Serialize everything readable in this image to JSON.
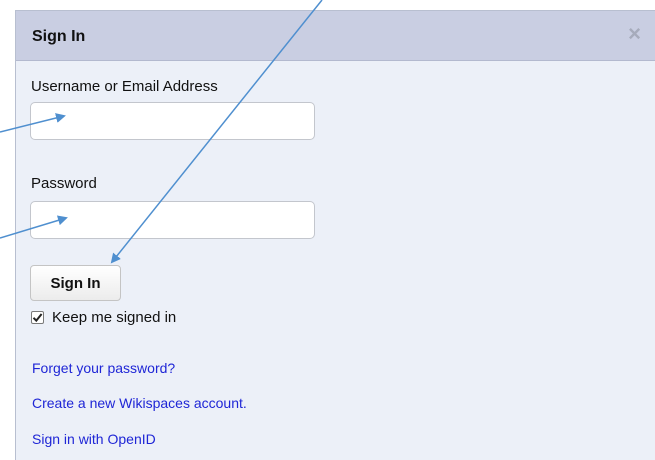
{
  "dialog": {
    "title": "Sign In",
    "close_glyph": "×"
  },
  "form": {
    "username_label": "Username or Email Address",
    "username_value": "",
    "password_label": "Password",
    "password_value": "",
    "submit_label": "Sign In",
    "keep_signed_in_label": "Keep me signed in",
    "keep_signed_in_checked": true
  },
  "links": {
    "forgot_password": "Forget your password?",
    "create_account": "Create a new Wikispaces account.",
    "openid": "Sign in with OpenID"
  },
  "colors": {
    "dialog_background": "#ecf0f8",
    "header_background": "#c9cee2",
    "link": "#1f26d6",
    "annotation_arrow": "#4f8fcf"
  },
  "icons": {
    "close": "close-icon",
    "checkbox": "checkmark-icon"
  }
}
